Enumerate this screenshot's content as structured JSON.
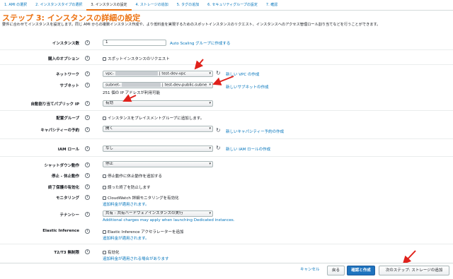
{
  "steps": [
    {
      "label": "1. AMI の選択"
    },
    {
      "label": "2. インスタンスタイプの選択"
    },
    {
      "label": "3. インスタンスの設定"
    },
    {
      "label": "4. ストレージの追加"
    },
    {
      "label": "5. タグの追加"
    },
    {
      "label": "6. セキュリティグループの設定"
    },
    {
      "label": "7. 確認"
    }
  ],
  "title": "ステップ 3: インスタンスの詳細の設定",
  "description": "要件に合わせてインスタンスを設定します。同じ AMI からの複数インスタンス作成や、より低料金を実現するためのスポットインスタンスのリクエスト、インスタンスへのアクセス管理ロール割り当てなどを行うことができます。",
  "info_icon": "i",
  "refresh_icon": "refresh-icon",
  "rows": {
    "instance_count": {
      "label": "インスタンス数",
      "value": "1",
      "link": "Auto Scaling グループに作成する"
    },
    "purchase_option": {
      "label": "購入のオプション",
      "checkbox": "スポットインスタンスのリクエスト"
    },
    "network": {
      "label": "ネットワーク",
      "prefix": "vpc-",
      "suffix": "| test-dev-vpc",
      "link": "新しい VPC の作成"
    },
    "subnet": {
      "label": "サブネット",
      "prefix": "subnet-",
      "suffix": "| test-dev-public-subne",
      "note": "251 個の IP アドレスが利用可能",
      "link": "新しいサブネットの作成"
    },
    "public_ip": {
      "label": "自動割り当てパブリック IP",
      "value": "有効"
    },
    "placement": {
      "label": "配置グループ",
      "checkbox": "インスタンスをプレイスメントグループに追加します。"
    },
    "capacity": {
      "label": "キャパシティーの予約",
      "value": "開く",
      "link": "新しいキャパシティー予約の作成"
    },
    "iam": {
      "label": "IAM ロール",
      "value": "なし",
      "link": "新しい IAM ロールの作成"
    },
    "shutdown": {
      "label": "シャットダウン動作",
      "value": "停止"
    },
    "stop_hibernate": {
      "label": "停止 - 休止動作",
      "checkbox": "停止動作に休止動作を追加する"
    },
    "termination": {
      "label": "終了保護の有効化",
      "checkbox": "誤った終了を防止します"
    },
    "monitoring": {
      "label": "モニタリング",
      "checkbox": "CloudWatch 詳細モニタリングを有効化",
      "note": "追加料金が適用されます。"
    },
    "tenancy": {
      "label": "テナンシー",
      "value": "共有 - 共有ハードウェアインスタンスの実行",
      "note": "Additional charges may apply when launching Dedicated instances."
    },
    "elastic_inference": {
      "label": "Elastic Inference",
      "checkbox": "Elastic Inference アクセラレーターを追加",
      "note": "追加料金が適用されます。"
    },
    "t2t3": {
      "label": "T2/T3 無制限",
      "checkbox": "有効化",
      "note": "追加料金が適用される場合があります"
    }
  },
  "footer": {
    "cancel": "キャンセル",
    "back": "戻る",
    "review_launch": "確認と作成",
    "next": "次のステップ: ストレージの追加"
  },
  "colors": {
    "accent": "#ec7211",
    "link": "#0073bb",
    "primary_button": "#1e73be",
    "annotation": "#e0211b"
  }
}
